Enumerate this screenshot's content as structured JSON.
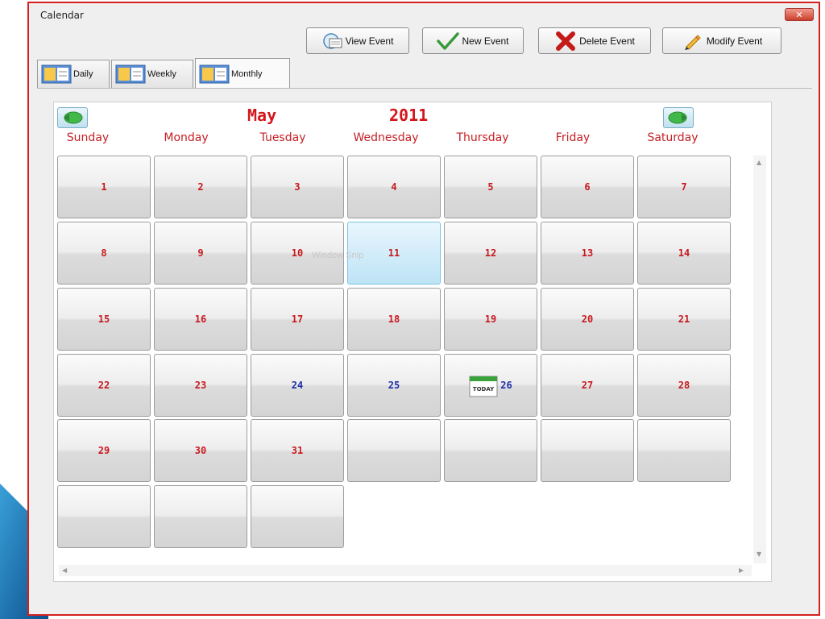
{
  "window": {
    "title": "Calendar",
    "close_glyph": "✕"
  },
  "toolbar": {
    "view_event": "View Event",
    "new_event": "New Event",
    "delete_event": "Delete Event",
    "modify_event": "Modify Event"
  },
  "tabs": [
    {
      "label": "Daily",
      "active": false
    },
    {
      "label": "Weekly",
      "active": false
    },
    {
      "label": "Monthly",
      "active": true
    }
  ],
  "calendar": {
    "month": "May",
    "year": "2011",
    "weekdays": [
      "Sunday",
      "Monday",
      "Tuesday",
      "Wednesday",
      "Thursday",
      "Friday",
      "Saturday"
    ],
    "weeks": [
      [
        "1",
        "2",
        "3",
        "4",
        "5",
        "6",
        "7"
      ],
      [
        "8",
        "9",
        "10",
        "11",
        "12",
        "13",
        "14"
      ],
      [
        "15",
        "16",
        "17",
        "18",
        "19",
        "20",
        "21"
      ],
      [
        "22",
        "23",
        "24",
        "25",
        "26",
        "27",
        "28"
      ],
      [
        "29",
        "30",
        "31",
        "",
        "",
        "",
        ""
      ],
      [
        "",
        "",
        ""
      ]
    ],
    "selected_day": "11",
    "today_day": "26",
    "today_badge": "TODAY",
    "blue_days": [
      "24",
      "25",
      "26"
    ],
    "watermark": "Window Snip"
  },
  "colors": {
    "accent_red": "#d3161b",
    "event_blue": "#1f2fa8",
    "selected_blue": "#bde3f6",
    "window_border": "#d62020"
  }
}
